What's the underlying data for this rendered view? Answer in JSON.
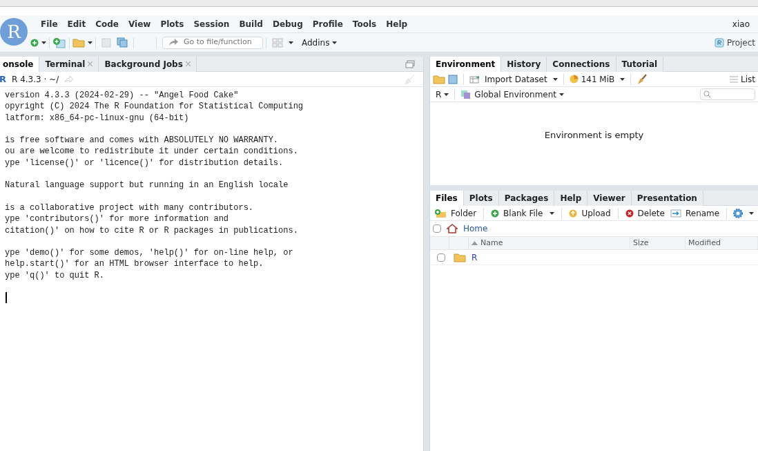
{
  "logo": "R",
  "menu": {
    "items": [
      "File",
      "Edit",
      "Code",
      "View",
      "Plots",
      "Session",
      "Build",
      "Debug",
      "Profile",
      "Tools",
      "Help"
    ],
    "user": "xiao"
  },
  "toolbar": {
    "goto_placeholder": "Go to file/function",
    "addins": "Addins",
    "project": "Project"
  },
  "console_pane": {
    "tabs": [
      {
        "label": "onsole",
        "selected": true,
        "closable": false
      },
      {
        "label": "Terminal",
        "selected": false,
        "closable": true
      },
      {
        "label": "Background Jobs",
        "selected": false,
        "closable": true
      }
    ],
    "language_badge": "R",
    "path": "R 4.3.3 · ~/",
    "paragraphs": [
      [
        "version 4.3.3 (2024-02-29) -- \"Angel Food Cake\"",
        "opyright (C) 2024 The R Foundation for Statistical Computing",
        "latform: x86_64-pc-linux-gnu (64-bit)"
      ],
      [
        "is free software and comes with ABSOLUTELY NO WARRANTY.",
        "ou are welcome to redistribute it under certain conditions.",
        "ype 'license()' or 'licence()' for distribution details."
      ],
      [
        "Natural language support but running in an English locale"
      ],
      [
        "is a collaborative project with many contributors.",
        "ype 'contributors()' for more information and",
        "citation()' on how to cite R or R packages in publications."
      ],
      [
        "ype 'demo()' for some demos, 'help()' for on-line help, or",
        "help.start()' for an HTML browser interface to help.",
        "ype 'q()' to quit R."
      ]
    ]
  },
  "environment_pane": {
    "tabs": [
      {
        "label": "Environment",
        "selected": true
      },
      {
        "label": "History",
        "selected": false
      },
      {
        "label": "Connections",
        "selected": false
      },
      {
        "label": "Tutorial",
        "selected": false
      }
    ],
    "import": "Import Dataset",
    "memory": "141 MiB",
    "view": "List",
    "language": "R",
    "scope": "Global Environment",
    "message": "Environment is empty"
  },
  "files_pane": {
    "tabs": [
      {
        "label": "Files",
        "selected": true
      },
      {
        "label": "Plots",
        "selected": false
      },
      {
        "label": "Packages",
        "selected": false
      },
      {
        "label": "Help",
        "selected": false
      },
      {
        "label": "Viewer",
        "selected": false
      },
      {
        "label": "Presentation",
        "selected": false
      }
    ],
    "actions": [
      {
        "kind": "folder",
        "label": "Folder",
        "menu": false
      },
      {
        "kind": "blank",
        "label": "Blank File",
        "menu": true
      },
      {
        "kind": "upload",
        "label": "Upload",
        "menu": false
      },
      {
        "kind": "delete",
        "label": "Delete",
        "menu": false
      },
      {
        "kind": "rename",
        "label": "Rename",
        "menu": false
      }
    ],
    "select_all_checked": false,
    "breadcrumb": "Home",
    "columns": [
      "Name",
      "Size",
      "Modified"
    ],
    "rows": [
      {
        "name": "R",
        "checked": false
      }
    ]
  }
}
